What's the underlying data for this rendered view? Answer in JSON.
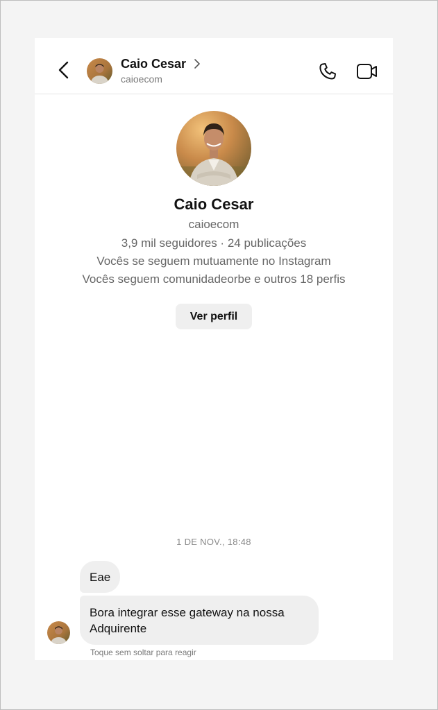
{
  "header": {
    "name": "Caio Cesar",
    "username": "caioecom",
    "icons": {
      "back": "back-arrow-icon",
      "chevron": "chevron-right-icon",
      "call": "phone-icon",
      "video": "video-camera-icon"
    }
  },
  "profile": {
    "name": "Caio Cesar",
    "username": "caioecom",
    "stats": "3,9 mil seguidores · 24 publicações",
    "mutual": "Vocês se seguem mutuamente no Instagram",
    "following": "Vocês seguem comunidadeorbe e outros 18 perfis",
    "button_label": "Ver perfil"
  },
  "chat": {
    "timestamp": "1 DE NOV., 18:48",
    "messages": [
      {
        "text": "Eae"
      },
      {
        "text": "Bora integrar esse gateway na nossa Adquirente"
      }
    ],
    "hint": "Toque sem soltar para reagir"
  },
  "colors": {
    "background": "#f4f4f4",
    "panel": "#ffffff",
    "bubble": "#efefef",
    "secondary_text": "#7a7a7a"
  }
}
